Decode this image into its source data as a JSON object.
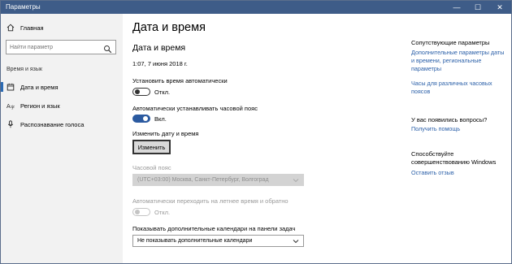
{
  "window": {
    "title": "Параметры",
    "minimize": "—",
    "maximize": "☐",
    "close": "✕"
  },
  "sidebar": {
    "home": "Главная",
    "search_placeholder": "Найти параметр",
    "section": "Время и язык",
    "items": [
      {
        "label": "Дата и время",
        "icon": "calendar-icon",
        "selected": true
      },
      {
        "label": "Регион и язык",
        "icon": "region-icon",
        "selected": false
      },
      {
        "label": "Распознавание голоса",
        "icon": "microphone-icon",
        "selected": false
      }
    ]
  },
  "main": {
    "page_title": "Дата и время",
    "section_title": "Дата и время",
    "current_datetime": "1:07, 7 июня 2018 г.",
    "auto_time": {
      "label": "Установить время автоматически",
      "state": "Откл."
    },
    "auto_timezone": {
      "label": "Автоматически устанавливать часовой пояс",
      "state": "Вкл."
    },
    "change": {
      "label": "Изменить дату и время",
      "button": "Изменить"
    },
    "timezone": {
      "label": "Часовой пояс",
      "value": "(UTC+03:00) Москва, Санкт-Петербург, Волгоград"
    },
    "dst": {
      "label": "Автоматически переходить на летнее время и обратно",
      "state": "Откл."
    },
    "calendars": {
      "label": "Показывать дополнительные календари на панели задач",
      "value": "Не показывать дополнительные календари"
    }
  },
  "related": {
    "title": "Сопутствующие параметры",
    "link1_line1": "Дополнительные параметры даты",
    "link1_line2": "и времени, региональные",
    "link1_line3": "параметры",
    "link2_line1": "Часы для различных часовых",
    "link2_line2": "поясов",
    "question_title": "У вас появились вопросы?",
    "help_link": "Получить помощь",
    "improve_line1": "Способствуйте",
    "improve_line2": "совершенствованию Windows",
    "feedback_link": "Оставить отзыв"
  },
  "colors": {
    "titlebar": "#3e5c88",
    "accent": "#2b5aa0",
    "link": "#2a5fa8",
    "sidebar": "#f2f2f2"
  }
}
